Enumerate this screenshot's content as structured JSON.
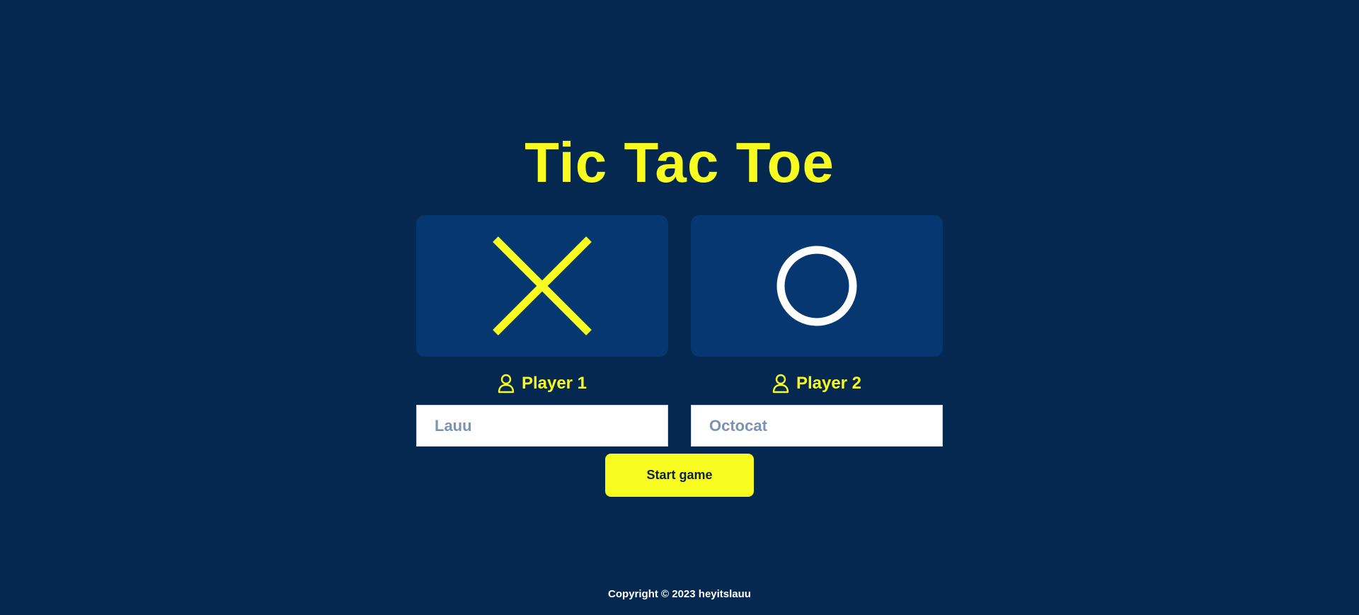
{
  "title": "Tic Tac Toe",
  "players": [
    {
      "symbol_icon": "x-mark-icon",
      "symbol_color": "#f8fb1f",
      "label": "Player 1",
      "label_icon": "user-icon",
      "name_placeholder": "Lauu"
    },
    {
      "symbol_icon": "o-mark-icon",
      "symbol_color": "#ffffff",
      "label": "Player 2",
      "label_icon": "user-icon",
      "name_placeholder": "Octocat"
    }
  ],
  "start_button_label": "Start game",
  "footer": "Copyright © 2023 heyitslauu",
  "colors": {
    "background": "#052850",
    "card": "#073770",
    "accent": "#f8fb1f",
    "text_light": "#ffffff"
  }
}
